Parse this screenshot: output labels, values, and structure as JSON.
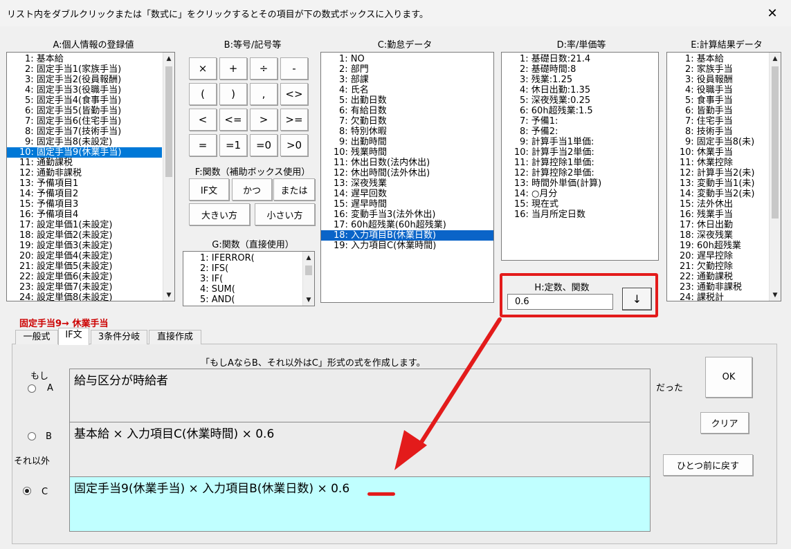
{
  "window": {
    "title": "リスト内をダブルクリックまたは「数式に」をクリックするとその項目が下の数式ボックスに入ります。",
    "close_glyph": "✕"
  },
  "sections": {
    "a": "A:個人情報の登録値",
    "b": "B:等号/記号等",
    "c": "C:勤怠データ",
    "d": "D:率/単価等",
    "e": "E:計算結果データ",
    "f": "F:関数（補助ボックス使用）",
    "g": "G:関数（直接使用）",
    "h": "H:定数、関数"
  },
  "list_a": {
    "selected_index": 9,
    "items": [
      "1: 基本給",
      "2: 固定手当1(家族手当)",
      "3: 固定手当2(役員報酬)",
      "4: 固定手当3(役職手当)",
      "5: 固定手当4(食事手当)",
      "6: 固定手当5(皆勤手当)",
      "7: 固定手当6(住宅手当)",
      "8: 固定手当7(技術手当)",
      "9: 固定手当8(未設定)",
      "10: 固定手当9(休業手当)",
      "11: 通勤課税",
      "12: 通勤非課税",
      "13: 予備項目1",
      "14: 予備項目2",
      "15: 予備項目3",
      "16: 予備項目4",
      "17: 設定単価1(未設定)",
      "18: 設定単価2(未設定)",
      "19: 設定単価3(未設定)",
      "20: 設定単価4(未設定)",
      "21: 設定単価5(未設定)",
      "22: 設定単価6(未設定)",
      "23: 設定単価7(未設定)",
      "24: 設定単価8(未設定)"
    ]
  },
  "buttons_b": [
    "×",
    "+",
    "÷",
    "-",
    "(",
    ")",
    ",",
    "<>",
    "<",
    "<=",
    ">",
    ">=",
    "=",
    "=1",
    "=0",
    ">0"
  ],
  "buttons_f": [
    "IF文",
    "かつ",
    "または",
    "大きい方",
    "小さい方"
  ],
  "list_g": {
    "items": [
      "1: IFERROR(",
      "2: IFS(",
      "3: IF(",
      "4: SUM(",
      "5: AND("
    ]
  },
  "list_c": {
    "selected_index": 17,
    "items": [
      "1: NO",
      "2: 部門",
      "3: 部課",
      "4: 氏名",
      "5: 出勤日数",
      "6: 有給日数",
      "7: 欠勤日数",
      "8: 特別休暇",
      "9: 出勤時間",
      "10: 残業時間",
      "11: 休出日数(法内休出)",
      "12: 休出時間(法外休出)",
      "13: 深夜残業",
      "14: 遅早回数",
      "15: 遅早時間",
      "16: 変動手当3(法外休出)",
      "17: 60h超残業(60h超残業)",
      "18: 入力項目B(休業日数)",
      "19: 入力項目C(休業時間)"
    ]
  },
  "list_d": {
    "items": [
      "1: 基礎日数:21.4",
      "2: 基礎時間:8",
      "3: 残業:1.25",
      "4: 休日出勤:1.35",
      "5: 深夜残業:0.25",
      "6: 60h超残業:1.5",
      "7: 予備1:",
      "8: 予備2:",
      "9: 計算手当1単価:",
      "10: 計算手当2単価:",
      "11: 計算控除1単価:",
      "12: 計算控除2単価:",
      "13: 時間外単価(計算)",
      "14: ○月分",
      "15: 現在式",
      "16: 当月所定日数"
    ]
  },
  "list_e": {
    "items": [
      "1: 基本給",
      "2: 家族手当",
      "3: 役員報酬",
      "4: 役職手当",
      "5: 食事手当",
      "6: 皆勤手当",
      "7: 住宅手当",
      "8: 技術手当",
      "9: 固定手当8(未)",
      "10: 休業手当",
      "11: 休業控除",
      "12: 計算手当2(未)",
      "13: 変動手当1(未)",
      "14: 変動手当2(未)",
      "15: 法外休出",
      "16: 残業手当",
      "17: 休日出勤",
      "18: 深夜残業",
      "19: 60h超残業",
      "20: 遅早控除",
      "21: 欠勤控除",
      "22: 通勤課税",
      "23: 通勤非課税",
      "24: 課税計"
    ]
  },
  "h_value": "0.6",
  "h_button": "↓",
  "current_item": "固定手当9→ 休業手当",
  "tabs": [
    "一般式",
    "IF文",
    "3条件分岐",
    "直接作成"
  ],
  "active_tab": 1,
  "panel": {
    "description": "「もしAならB、それ以外はC」形式の式を作成します。",
    "label_if": "もし",
    "label_a": "A",
    "label_b": "B",
    "label_else": "それ以外",
    "label_c": "C",
    "label_datta": "だった",
    "field_a": "給与区分が時給者",
    "field_b": "基本給 × 入力項目C(休業時間) × 0.6",
    "field_c": "固定手当9(休業手当) × 入力項目B(休業日数) × 0.6",
    "ok": "OK",
    "clear": "クリア",
    "undo": "ひとつ前に戻す"
  },
  "colors": {
    "highlight": "#e31b1b",
    "selection": "#0078d7",
    "active_field": "#c0ffff"
  }
}
